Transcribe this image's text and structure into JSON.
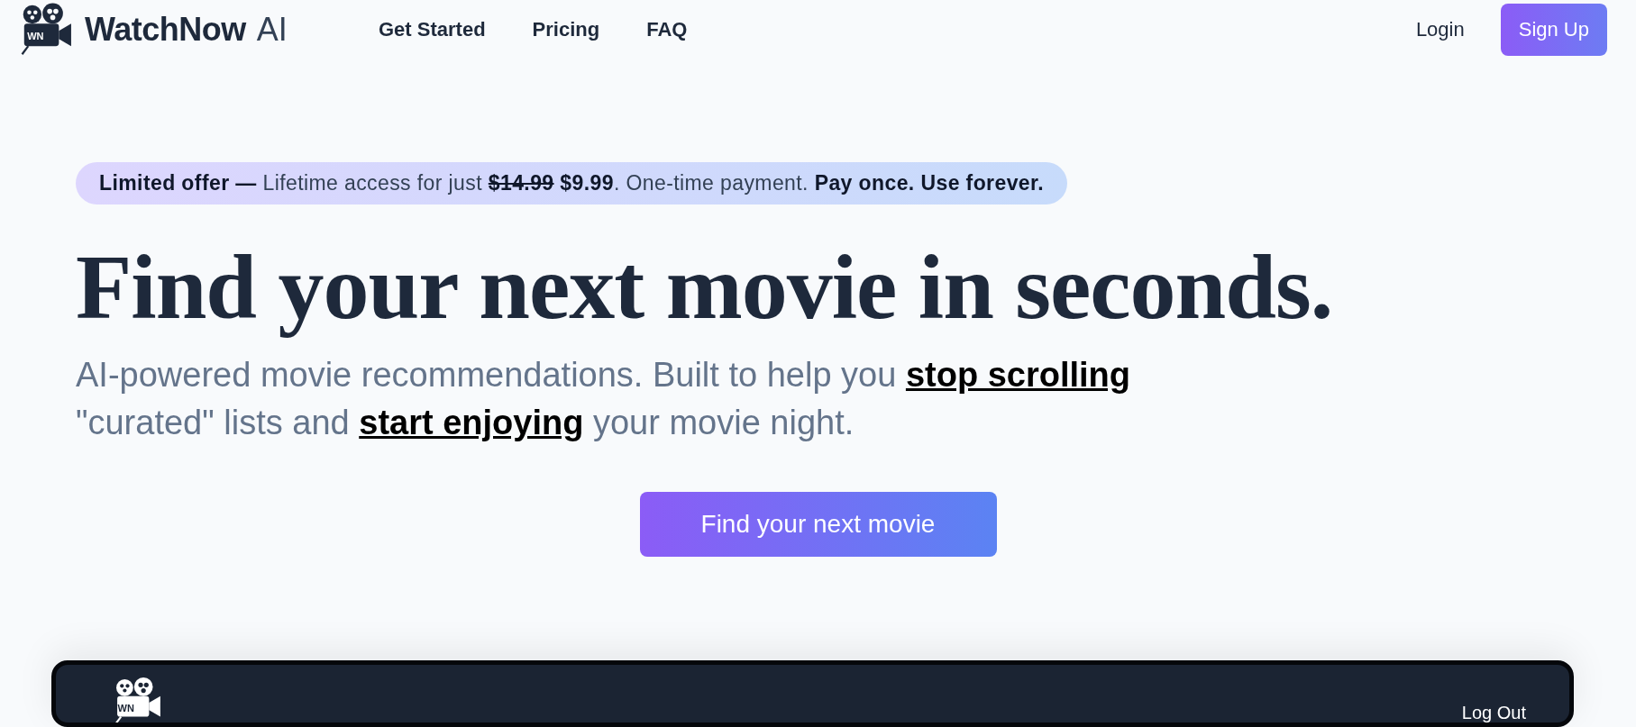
{
  "nav": {
    "logo_badge": "WN",
    "brand": "WatchNow",
    "brand_suffix": "AI",
    "links": [
      {
        "label": "Get Started"
      },
      {
        "label": "Pricing"
      },
      {
        "label": "FAQ"
      }
    ],
    "login": "Login",
    "signup": "Sign Up"
  },
  "offer": [
    {
      "kind": "bold",
      "text": "Limited offer "
    },
    {
      "kind": "bold",
      "text": " — "
    },
    {
      "kind": "plain",
      "text": "Lifetime access for just "
    },
    {
      "kind": "strike",
      "text": "$14.99"
    },
    {
      "kind": "bold",
      "text": " $9.99"
    },
    {
      "kind": "plain",
      "text": ". One-time payment. "
    },
    {
      "kind": "bold",
      "text": "Pay once. Use forever."
    }
  ],
  "headline": "Find your next movie in seconds.",
  "subtitle": [
    {
      "kind": "text",
      "text": "AI-powered movie recommendations. Built to help you "
    },
    {
      "kind": "link",
      "text": "stop scrolling"
    },
    {
      "kind": "text",
      "text": " \"curated\" lists and "
    },
    {
      "kind": "link",
      "text": "start enjoying"
    },
    {
      "kind": "text",
      "text": " your movie night."
    }
  ],
  "cta": "Find your next movie",
  "preview": {
    "logo_badge": "WN",
    "logout": "Log Out"
  }
}
